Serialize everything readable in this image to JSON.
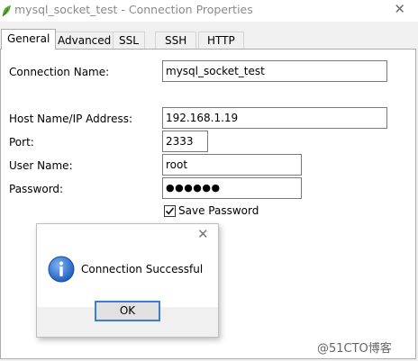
{
  "window": {
    "title": "mysql_socket_test - Connection Properties",
    "close_glyph": "✕",
    "icon": "navicat-leaf-icon"
  },
  "tabs": [
    {
      "label": "General",
      "active": true
    },
    {
      "label": "Advanced",
      "active": false
    },
    {
      "label": "SSL",
      "active": false
    },
    {
      "label": "SSH",
      "active": false
    },
    {
      "label": "HTTP",
      "active": false
    }
  ],
  "form": {
    "connection_name_label": "Connection Name:",
    "connection_name_value": "mysql_socket_test",
    "host_label": "Host Name/IP Address:",
    "host_value": "192.168.1.19",
    "port_label": "Port:",
    "port_value": "2333",
    "user_label": "User Name:",
    "user_value": "root",
    "password_label": "Password:",
    "password_value": "●●●●●●",
    "save_password_label": "Save Password",
    "save_password_checked": true
  },
  "dialog": {
    "close_glyph": "✕",
    "message": "Connection Successful",
    "ok_label": "OK",
    "icon": "info-icon"
  },
  "watermark": "@51CTO博客",
  "colors": {
    "accent": "#3c7fd2",
    "info_blue": "#1f5fbf",
    "title_gray": "#8a8a8a"
  }
}
